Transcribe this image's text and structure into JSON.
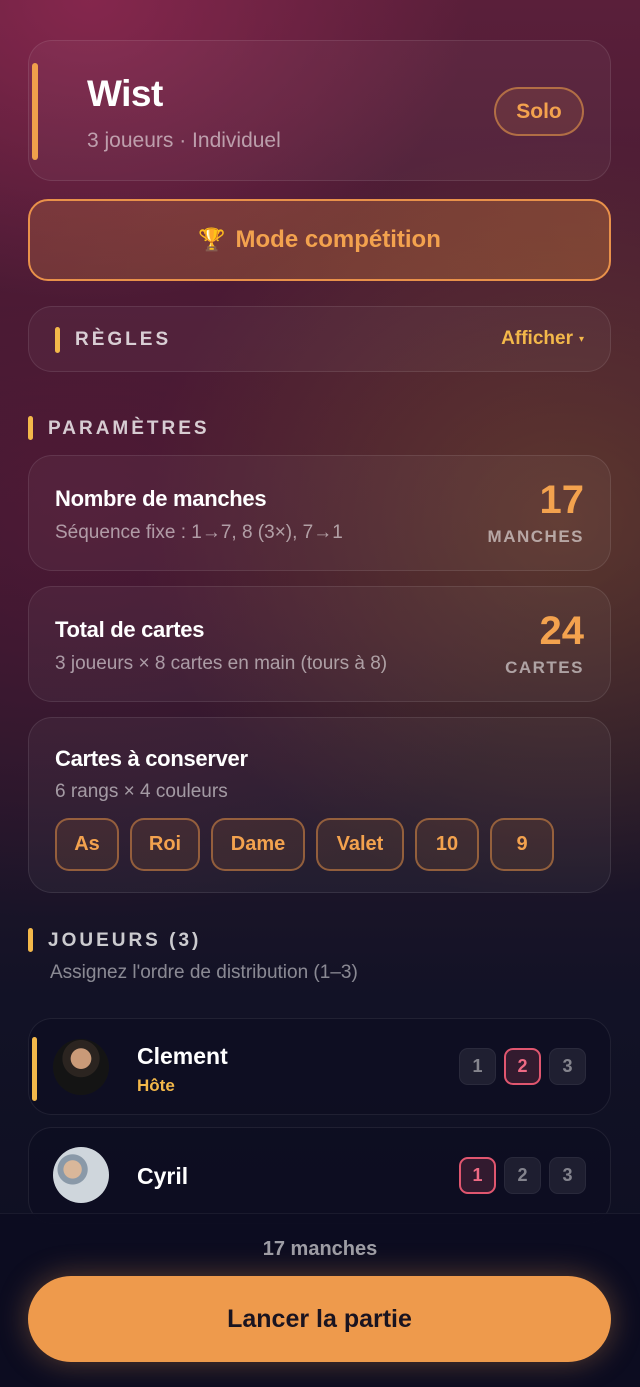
{
  "game": {
    "title": "Wist",
    "subtitle": "3 joueurs · Individuel",
    "mode_badge": "Solo"
  },
  "competition": {
    "icon": "🏆",
    "label": "Mode compétition"
  },
  "rules": {
    "title": "RÈGLES",
    "toggle_label": "Afficher",
    "toggle_icon": "▾"
  },
  "parameters": {
    "section_title": "PARAMÈTRES",
    "rounds": {
      "title": "Nombre de manches",
      "description": "Séquence fixe : 1→7, 8 (3×), 7→1",
      "value": "17",
      "unit": "MANCHES"
    },
    "total_cards": {
      "title": "Total de cartes",
      "description": "3 joueurs × 8 cartes en main (tours à 8)",
      "value": "24",
      "unit": "CARTES"
    },
    "keep_cards": {
      "title": "Cartes à conserver",
      "description": "6 rangs × 4 couleurs",
      "ranks": [
        "As",
        "Roi",
        "Dame",
        "Valet",
        "10",
        "9"
      ]
    }
  },
  "players": {
    "section_title": "JOUEURS (3)",
    "hint": "Assignez l'ordre de distribution (1–3)",
    "order_options": [
      "1",
      "2",
      "3"
    ],
    "list": [
      {
        "name": "Clement",
        "role": "Hôte",
        "selected_order": 2
      },
      {
        "name": "Cyril",
        "role": "",
        "selected_order": 1
      }
    ]
  },
  "footer": {
    "summary": "17 manches",
    "launch_label": "Lancer la partie"
  },
  "colors": {
    "accent_orange": "#f3a24e",
    "accent_yellow": "#f3b84a",
    "order_active": "#e0566f",
    "launch_button": "#ee9a4c"
  }
}
